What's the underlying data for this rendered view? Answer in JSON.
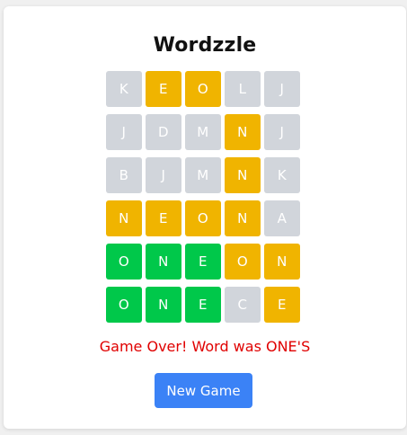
{
  "title": "Wordzzle",
  "board": [
    [
      {
        "letter": "K",
        "state": "absent"
      },
      {
        "letter": "E",
        "state": "present"
      },
      {
        "letter": "O",
        "state": "present"
      },
      {
        "letter": "L",
        "state": "absent"
      },
      {
        "letter": "J",
        "state": "absent"
      }
    ],
    [
      {
        "letter": "J",
        "state": "absent"
      },
      {
        "letter": "D",
        "state": "absent"
      },
      {
        "letter": "M",
        "state": "absent"
      },
      {
        "letter": "N",
        "state": "present"
      },
      {
        "letter": "J",
        "state": "absent"
      }
    ],
    [
      {
        "letter": "B",
        "state": "absent"
      },
      {
        "letter": "J",
        "state": "absent"
      },
      {
        "letter": "M",
        "state": "absent"
      },
      {
        "letter": "N",
        "state": "present"
      },
      {
        "letter": "K",
        "state": "absent"
      }
    ],
    [
      {
        "letter": "N",
        "state": "present"
      },
      {
        "letter": "E",
        "state": "present"
      },
      {
        "letter": "O",
        "state": "present"
      },
      {
        "letter": "N",
        "state": "present"
      },
      {
        "letter": "A",
        "state": "absent"
      }
    ],
    [
      {
        "letter": "O",
        "state": "correct"
      },
      {
        "letter": "N",
        "state": "correct"
      },
      {
        "letter": "E",
        "state": "correct"
      },
      {
        "letter": "O",
        "state": "present"
      },
      {
        "letter": "N",
        "state": "present"
      }
    ],
    [
      {
        "letter": "O",
        "state": "correct"
      },
      {
        "letter": "N",
        "state": "correct"
      },
      {
        "letter": "E",
        "state": "correct"
      },
      {
        "letter": "C",
        "state": "absent"
      },
      {
        "letter": "E",
        "state": "present"
      }
    ]
  ],
  "message": "Game Over! Word was ONE'S",
  "new_game_label": "New Game",
  "colors": {
    "absent": "#d1d5db",
    "present": "#f0b400",
    "correct": "#00c84a",
    "message": "#e00000",
    "button": "#3b82f6"
  }
}
